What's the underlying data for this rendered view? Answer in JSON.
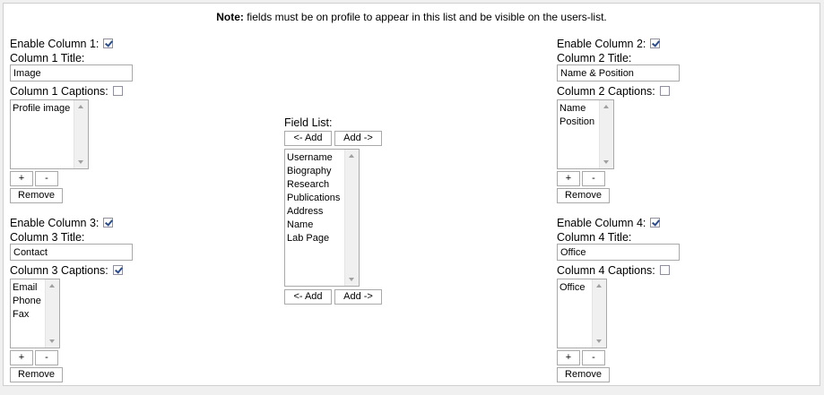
{
  "note": {
    "label": "Note:",
    "text": " fields must be on profile to appear in this list and be visible on the users-list."
  },
  "columns": [
    {
      "enable_label": "Enable Column 1:",
      "enabled": true,
      "title_label": "Column 1 Title:",
      "title_value": "Image",
      "captions_label": "Column 1 Captions:",
      "captions": false,
      "items": [
        "Profile image"
      ]
    },
    {
      "enable_label": "Enable Column 2:",
      "enabled": true,
      "title_label": "Column 2 Title:",
      "title_value": "Name & Position",
      "captions_label": "Column 2 Captions:",
      "captions": false,
      "items": [
        "Name",
        "Position"
      ]
    },
    {
      "enable_label": "Enable Column 3:",
      "enabled": true,
      "title_label": "Column 3 Title:",
      "title_value": "Contact",
      "captions_label": "Column 3 Captions:",
      "captions": true,
      "items": [
        "Email",
        "Phone",
        "Fax"
      ]
    },
    {
      "enable_label": "Enable Column 4:",
      "enabled": true,
      "title_label": "Column 4 Title:",
      "title_value": "Office",
      "captions_label": "Column 4 Captions:",
      "captions": false,
      "items": [
        "Office"
      ]
    }
  ],
  "buttons": {
    "plus": "+",
    "minus": "-",
    "remove": "Remove",
    "add_left": "<- Add",
    "add_right": "Add ->"
  },
  "field_list": {
    "label": "Field List:",
    "items": [
      "Username",
      "Biography",
      "Research",
      "Publications",
      "Address",
      "Name",
      "Lab Page"
    ]
  }
}
